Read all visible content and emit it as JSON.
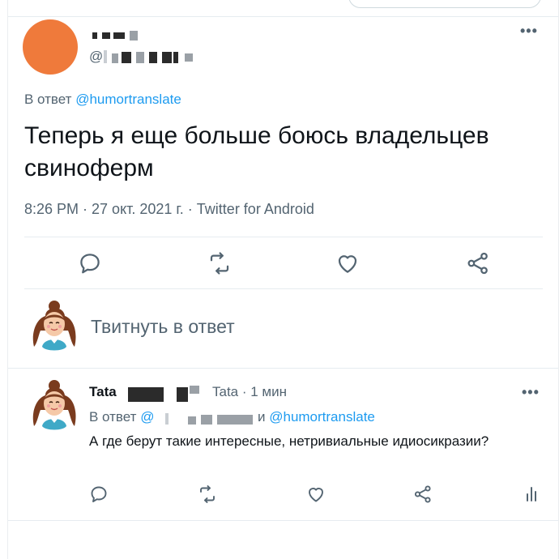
{
  "main_tweet": {
    "author_name": "",
    "author_handle_prefix": "@",
    "reply_to_label": "В ответ",
    "reply_to_handle": "@humortranslate",
    "text": "Теперь я еще больше боюсь владельцев свиноферм",
    "meta": "8:26 PM · 27 окт. 2021 г. · Twitter for Android",
    "more_icon": "more-icon"
  },
  "compose": {
    "placeholder": "Твитнуть в ответ"
  },
  "reply_tweet": {
    "author_name": "Tata",
    "handle_time": "Tata · 1 мин",
    "reply_to_label": "В ответ",
    "reply_to_handle_prefix": "@",
    "reply_to_conjunction": "и",
    "reply_to_handle": "@humortranslate",
    "text": "А где берут такие интересные, нетривиальные идиосикразии?"
  },
  "colors": {
    "link": "#1d9bf0",
    "secondary_text": "#536471",
    "avatar_orange": "#ef7a3b"
  }
}
